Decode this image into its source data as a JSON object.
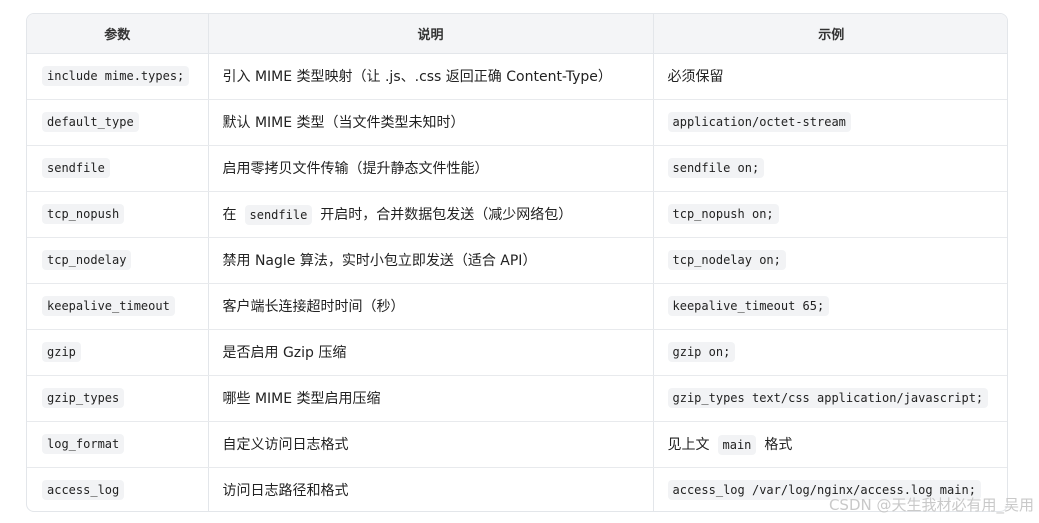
{
  "header": {
    "col_param": "参数",
    "col_desc": "说明",
    "col_example": "示例"
  },
  "rows": [
    {
      "param": "include mime.types;",
      "desc": "引入 MIME 类型映射（让 .js、.css 返回正确 Content-Type）",
      "example": "必须保留"
    },
    {
      "param": "default_type",
      "desc": "默认 MIME 类型（当文件类型未知时）",
      "example": "application/octet-stream"
    },
    {
      "param": "sendfile",
      "desc": "启用零拷贝文件传输（提升静态文件性能）",
      "example": "sendfile on;"
    },
    {
      "param": "tcp_nopush",
      "desc_pre": "在",
      "desc_code": "sendfile",
      "desc_post": "开启时，合并数据包发送（减少网络包）",
      "example": "tcp_nopush on;"
    },
    {
      "param": "tcp_nodelay",
      "desc": "禁用 Nagle 算法，实时小包立即发送（适合 API）",
      "example": "tcp_nodelay on;"
    },
    {
      "param": "keepalive_timeout",
      "desc": "客户端长连接超时时间（秒）",
      "example": "keepalive_timeout 65;"
    },
    {
      "param": "gzip",
      "desc": "是否启用 Gzip 压缩",
      "example": "gzip on;"
    },
    {
      "param": "gzip_types",
      "desc": "哪些 MIME 类型启用压缩",
      "example": "gzip_types text/css application/javascript;"
    },
    {
      "param": "log_format",
      "desc": "自定义访问日志格式",
      "example_pre": "见上文",
      "example_code": "main",
      "example_post": "格式"
    },
    {
      "param": "access_log",
      "desc": "访问日志路径和格式",
      "example": "access_log /var/log/nginx/access.log main;"
    }
  ],
  "watermark": "CSDN @天生我材必有用_吴用"
}
